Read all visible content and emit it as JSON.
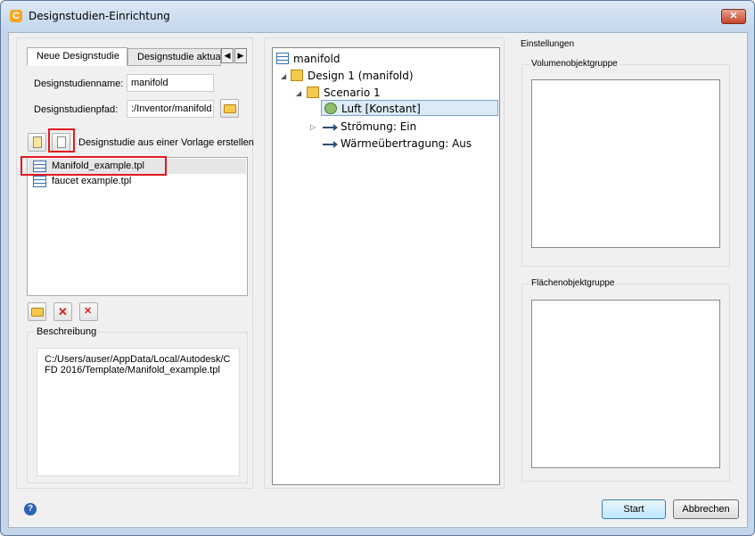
{
  "window": {
    "title": "Designstudien-Einrichtung",
    "close": "✕"
  },
  "tabs": [
    {
      "label": "Neue Designstudie"
    },
    {
      "label": "Designstudie aktualisieren"
    }
  ],
  "form": {
    "name_label": "Designstudienname:",
    "name_value": "manifold",
    "path_label": "Designstudienpfad:",
    "path_value": ":/Inventor/manifold"
  },
  "template": {
    "label": "Designstudie aus einer Vorlage erstellen",
    "items": [
      "Manifold_example.tpl",
      "faucet example.tpl"
    ]
  },
  "description": {
    "title": "Beschreibung",
    "text": "C:/Users/auser/AppData/Local/Autodesk/CFD 2016/Template/Manifold_example.tpl"
  },
  "tree": {
    "root": "manifold",
    "design": "Design 1 (manifold)",
    "scenario": "Scenario 1",
    "material": "Luft [Konstant]",
    "flow": "Strömung: Ein",
    "heat": "Wärmeübertragung: Aus"
  },
  "settings": {
    "title": "Einstellungen",
    "volume_group": "Volumenobjektgruppe",
    "surface_group": "Flächenobjektgruppe"
  },
  "buttons": {
    "start": "Start",
    "cancel": "Abbrechen",
    "help": "?"
  }
}
